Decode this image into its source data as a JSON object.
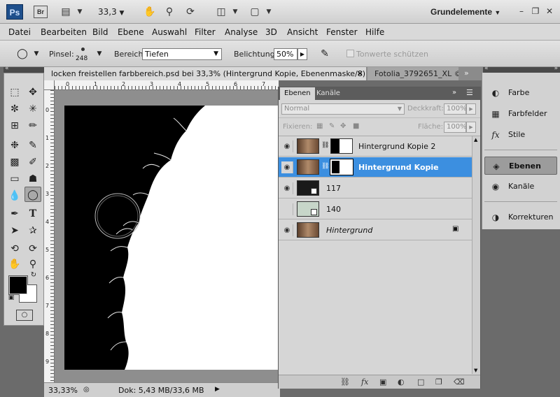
{
  "appbar": {
    "logo": "Ps",
    "bridge": "Br",
    "zoom_value": "33,3",
    "workspace": "Grundelemente",
    "icons": [
      "film-icon",
      "hand-icon",
      "zoom-icon",
      "rotate-icon",
      "layout-icon",
      "screen-mode-icon"
    ]
  },
  "menu": [
    "Datei",
    "Bearbeiten",
    "Bild",
    "Ebene",
    "Auswahl",
    "Filter",
    "Analyse",
    "3D",
    "Ansicht",
    "Fenster",
    "Hilfe"
  ],
  "options": {
    "brush_label": "Pinsel:",
    "brush_size": "248",
    "range_label": "Bereich:",
    "range_value": "Tiefen",
    "exposure_label": "Belichtung:",
    "exposure_value": "50%",
    "protect_tones": "Tonwerte schützen"
  },
  "doc_tabs": [
    {
      "label": "locken freistellen farbbereich.psd bei 33,3% (Hintergrund Kopie, Ebenenmaske/8) *"
    },
    {
      "label": "Fotolia_3792651_XL ©"
    }
  ],
  "rulers": {
    "h": [
      "0",
      "1",
      "2",
      "3",
      "4",
      "5",
      "6",
      "7"
    ],
    "v": [
      "0",
      "1",
      "2",
      "3",
      "4",
      "5",
      "6",
      "7",
      "8",
      "9"
    ]
  },
  "status": {
    "zoom": "33,33%",
    "doc": "Dok: 5,43 MB/33,6 MB"
  },
  "layers_panel": {
    "tab_layers": "Ebenen",
    "tab_channels": "Kanäle",
    "blend_mode": "Normal",
    "opacity_label": "Deckkraft:",
    "opacity_value": "100%",
    "lock_label": "Fixieren:",
    "fill_label": "Fläche:",
    "fill_value": "100%",
    "layers": [
      {
        "name": "Hintergrund Kopie 2",
        "visible": true,
        "selected": false
      },
      {
        "name": "Hintergrund Kopie",
        "visible": true,
        "selected": true
      },
      {
        "name": "117",
        "visible": true,
        "selected": false
      },
      {
        "name": "140",
        "visible": false,
        "selected": false
      },
      {
        "name": "Hintergrund",
        "visible": true,
        "selected": false
      }
    ]
  },
  "dock": {
    "items": [
      {
        "label": "Farbe",
        "icon": "color-icon"
      },
      {
        "label": "Farbfelder",
        "icon": "swatches-icon"
      },
      {
        "label": "Stile",
        "icon": "styles-icon"
      },
      {
        "label": "Ebenen",
        "icon": "layers-icon"
      },
      {
        "label": "Kanäle",
        "icon": "channels-icon"
      },
      {
        "label": "Korrekturen",
        "icon": "adjustments-icon"
      }
    ]
  },
  "colors": {
    "selection_blue": "#3c8fe0",
    "ps_blue": "#1e4f8c"
  }
}
